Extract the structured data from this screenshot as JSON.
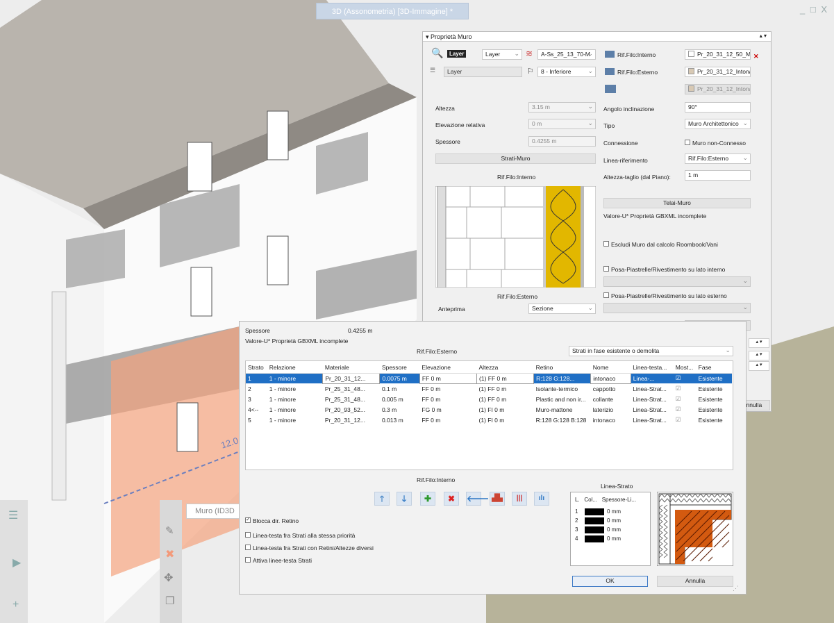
{
  "viewport": {
    "tab_title": "3D (Assonometria) [3D-Immagine] *",
    "window_controls": "_ □ X",
    "dimension_text": "12.0",
    "wall_tooltip": "Muro (ID3D"
  },
  "props": {
    "title": "Proprietà Muro",
    "layer_label": "Layer",
    "layer_value": "Layer",
    "layer_field": "Layer",
    "material_code": "A-Ss_25_13_70-M",
    "level_value": "8 - Inferiore",
    "rif_interno_label": "Rif.Filo:Interno",
    "rif_interno_value": "Pr_20_31_12_50_Ma",
    "rif_esterno_label": "Rif.Filo:Esterno",
    "rif_esterno_value": "Pr_20_31_12_Intona",
    "rif_third_value": "Pr_20_31_12_Intona",
    "altezza_label": "Altezza",
    "altezza_value": "3.15 m",
    "elev_label": "Elevazione relativa",
    "elev_value": "0 m",
    "spessore_label": "Spessore",
    "spessore_value": "0.4255 m",
    "strati_btn": "Strati-Muro",
    "preview_top": "Rif.Filo:Interno",
    "preview_bottom": "Rif.Filo:Esterno",
    "anteprima_label": "Anteprima",
    "anteprima_value": "Sezione",
    "angolo_label": "Angolo inclinazione",
    "angolo_value": "90°",
    "tipo_label": "Tipo",
    "tipo_value": "Muro Architettonico",
    "connessione_label": "Connessione",
    "non_connesso": "Muro non-Connesso",
    "linea_rif_label": "Linea-riferimento",
    "linea_rif_value": "Rif.Filo:Esterno",
    "altezza_taglio_label": "Altezza-taglio (dal Piano):",
    "altezza_taglio_value": "1 m",
    "telai_btn": "Telai-Muro",
    "valore_u": "Valore-U* Proprietà GBXML incomplete",
    "escludi": "Escludi Muro dal calcolo Roombook/Vani",
    "posa_interno": "Posa-Piastrelle/Rivestimento su lato interno",
    "posa_esterno": "Posa-Piastrelle/Rivestimento su lato esterno",
    "annulla": "Annulla"
  },
  "strati": {
    "spessore_label": "Spessore",
    "spessore_value": "0.4255 m",
    "valore_u": "Valore-U* Proprietà GBXML incomplete",
    "rif_esterno": "Rif.Filo:Esterno",
    "phase_filter": "Strati in fase esistente o demolita",
    "columns": [
      "Strato",
      "Relazione",
      "Materiale",
      "Spessore",
      "Elevazione",
      "Altezza",
      "Retino",
      "Nome",
      "Linea-testa...",
      "Most...",
      "Fase"
    ],
    "rows": [
      {
        "strato": "1",
        "rel": "1 - minore",
        "mat": "Pr_20_31_12...",
        "sp": "0.0075 m",
        "elev": "FF 0 m",
        "alt": "(1) FF 0 m",
        "ret": "R:128 G:128...",
        "nome": "intonaco",
        "linea": "Linea-...",
        "fase": "Esistente"
      },
      {
        "strato": "2",
        "rel": "1 - minore",
        "mat": "Pr_25_31_48...",
        "sp": "0.1 m",
        "elev": "FF 0 m",
        "alt": "(1) FF 0 m",
        "ret": "Isolante-termico",
        "nome": "cappotto",
        "linea": "Linea-Strat...",
        "fase": "Esistente"
      },
      {
        "strato": "3",
        "rel": "1 - minore",
        "mat": "Pr_25_31_48...",
        "sp": "0.005 m",
        "elev": "FF 0 m",
        "alt": "(1) FF 0 m",
        "ret": "Plastic and non ir...",
        "nome": "collante",
        "linea": "Linea-Strat...",
        "fase": "Esistente"
      },
      {
        "strato": "4<--",
        "rel": "1 - minore",
        "mat": "Pr_20_93_52...",
        "sp": "0.3 m",
        "elev": "FG 0 m",
        "alt": "(1) FI 0 m",
        "ret": "Muro-mattone",
        "nome": "laterizio",
        "linea": "Linea-Strat...",
        "fase": "Esistente"
      },
      {
        "strato": "5",
        "rel": "1 - minore",
        "mat": "Pr_20_31_12...",
        "sp": "0.013 m",
        "elev": "FF 0 m",
        "alt": "(1) FI 0 m",
        "ret": "R:128 G:128 B:128",
        "nome": "intonaco",
        "linea": "Linea-Strat...",
        "fase": "Esistente"
      }
    ],
    "rif_interno": "Rif.Filo:Interno",
    "linea_strato_title": "Linea-Strato",
    "ls_columns": [
      "L.",
      "Col...",
      "Spessore-Li..."
    ],
    "ls_rows": [
      {
        "n": "1",
        "t": "0 mm"
      },
      {
        "n": "2",
        "t": "0 mm"
      },
      {
        "n": "3",
        "t": "0 mm"
      },
      {
        "n": "4",
        "t": "0 mm"
      }
    ],
    "blocca": "Blocca dir. Retino",
    "opt1": "Linea-testa fra Strati alla stessa priorità",
    "opt2": "Linea-testa fra Strati con Retini/Altezze diversi",
    "opt3": "Attiva linee-testa Strati",
    "ok": "OK",
    "annulla": "Annulla"
  },
  "colors": {
    "selection": "#1f6fc5",
    "insulation": "#e2b700",
    "hatch": "#d35a10"
  }
}
